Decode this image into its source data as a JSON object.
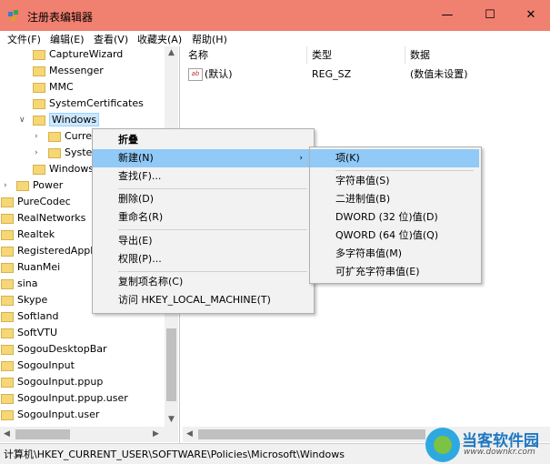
{
  "window": {
    "title": "注册表编辑器",
    "minimize": "—",
    "maximize": "☐",
    "close": "✕"
  },
  "menu": [
    "文件(F)",
    "编辑(E)",
    "查看(V)",
    "收藏夹(A)",
    "帮助(H)"
  ],
  "tree": {
    "items": [
      {
        "label": "CaptureWizard"
      },
      {
        "label": "Messenger"
      },
      {
        "label": "MMC"
      },
      {
        "label": "SystemCertificates"
      },
      {
        "label": "Windows"
      },
      {
        "label": "Curre"
      },
      {
        "label": "Syster"
      },
      {
        "label": "Windows"
      },
      {
        "label": "Power"
      },
      {
        "label": "PureCodec"
      },
      {
        "label": "RealNetworks"
      },
      {
        "label": "Realtek"
      },
      {
        "label": "RegisteredAppl"
      },
      {
        "label": "RuanMei"
      },
      {
        "label": "sina"
      },
      {
        "label": "Skype"
      },
      {
        "label": "Softland"
      },
      {
        "label": "SoftVTU"
      },
      {
        "label": "SogouDesktopBar"
      },
      {
        "label": "SogouInput"
      },
      {
        "label": "SogouInput.ppup"
      },
      {
        "label": "SogouInput.ppup.user"
      },
      {
        "label": "SogouInput.user"
      }
    ]
  },
  "list": {
    "headers": {
      "name": "名称",
      "type": "类型",
      "data": "数据"
    },
    "rows": [
      {
        "name": "(默认)",
        "type": "REG_SZ",
        "data": "(数值未设置)",
        "icon": "ab"
      }
    ]
  },
  "context_menu": {
    "items": [
      "折叠",
      "新建(N)",
      "查找(F)...",
      "删除(D)",
      "重命名(R)",
      "导出(E)",
      "权限(P)...",
      "复制项名称(C)",
      "访问 HKEY_LOCAL_MACHINE(T)"
    ]
  },
  "submenu": {
    "items": [
      "项(K)",
      "字符串值(S)",
      "二进制值(B)",
      "DWORD (32 位)值(D)",
      "QWORD (64 位)值(Q)",
      "多字符串值(M)",
      "可扩充字符串值(E)"
    ]
  },
  "status": {
    "path": "计算机\\HKEY_CURRENT_USER\\SOFTWARE\\Policies\\Microsoft\\Windows"
  },
  "watermark": {
    "brand": "当客软件园",
    "url": "www.downkr.com"
  },
  "colors": {
    "titlebar": "#f08070",
    "highlight": "#91c9f7",
    "selected": "#cce8ff"
  }
}
